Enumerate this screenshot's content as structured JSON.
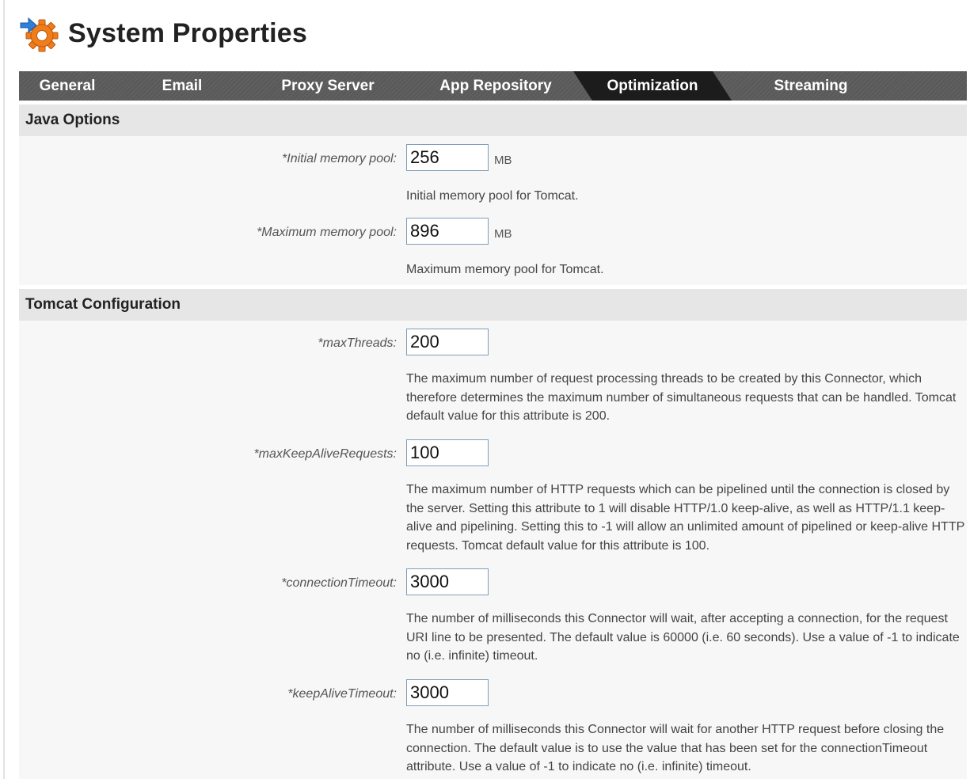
{
  "page": {
    "title": "System Properties"
  },
  "tabs": [
    {
      "label": "General",
      "active": false
    },
    {
      "label": "Email",
      "active": false
    },
    {
      "label": "Proxy Server",
      "active": false
    },
    {
      "label": "App Repository",
      "active": false
    },
    {
      "label": "Optimization",
      "active": true
    },
    {
      "label": "Streaming",
      "active": false
    }
  ],
  "java_options": {
    "title": "Java Options",
    "initial_pool": {
      "label": "*Initial memory pool:",
      "value": "256",
      "unit": "MB",
      "help": "Initial memory pool for Tomcat."
    },
    "max_pool": {
      "label": "*Maximum memory pool:",
      "value": "896",
      "unit": "MB",
      "help": "Maximum memory pool for Tomcat."
    }
  },
  "tomcat": {
    "title": "Tomcat Configuration",
    "max_threads": {
      "label": "*maxThreads:",
      "value": "200",
      "help": "The maximum number of request processing threads to be created by this Connector, which therefore determines the maximum number of simultaneous requests that can be handled. Tomcat default value for this attribute is 200."
    },
    "max_keep_alive": {
      "label": "*maxKeepAliveRequests:",
      "value": "100",
      "help": "The maximum number of HTTP requests which can be pipelined until the connection is closed by the server. Setting this attribute to 1 will disable HTTP/1.0 keep-alive, as well as HTTP/1.1 keep-alive and pipelining. Setting this to -1 will allow an unlimited amount of pipelined or keep-alive HTTP requests. Tomcat default value for this attribute is 100."
    },
    "connection_timeout": {
      "label": "*connectionTimeout:",
      "value": "3000",
      "help": "The number of milliseconds this Connector will wait, after accepting a connection, for the request URI line to be presented. The default value is 60000 (i.e. 60 seconds). Use a value of -1 to indicate no (i.e. infinite) timeout."
    },
    "keep_alive_timeout": {
      "label": "*keepAliveTimeout:",
      "value": "3000",
      "help": "The number of milliseconds this Connector will wait for another HTTP request before closing the connection. The default value is to use the value that has been set for the connectionTimeout attribute. Use a value of -1 to indicate no (i.e. infinite) timeout."
    }
  },
  "colors": {
    "tab_bar": "#5a5a5a",
    "tab_active": "#1c1c1c",
    "section_header": "#e6e6e6",
    "section_body": "#f7f7f7",
    "icon_gear": "#f07d1a",
    "icon_arrow": "#2f7fd8"
  },
  "icons": {
    "title_icon": "gear-with-arrow-icon"
  }
}
